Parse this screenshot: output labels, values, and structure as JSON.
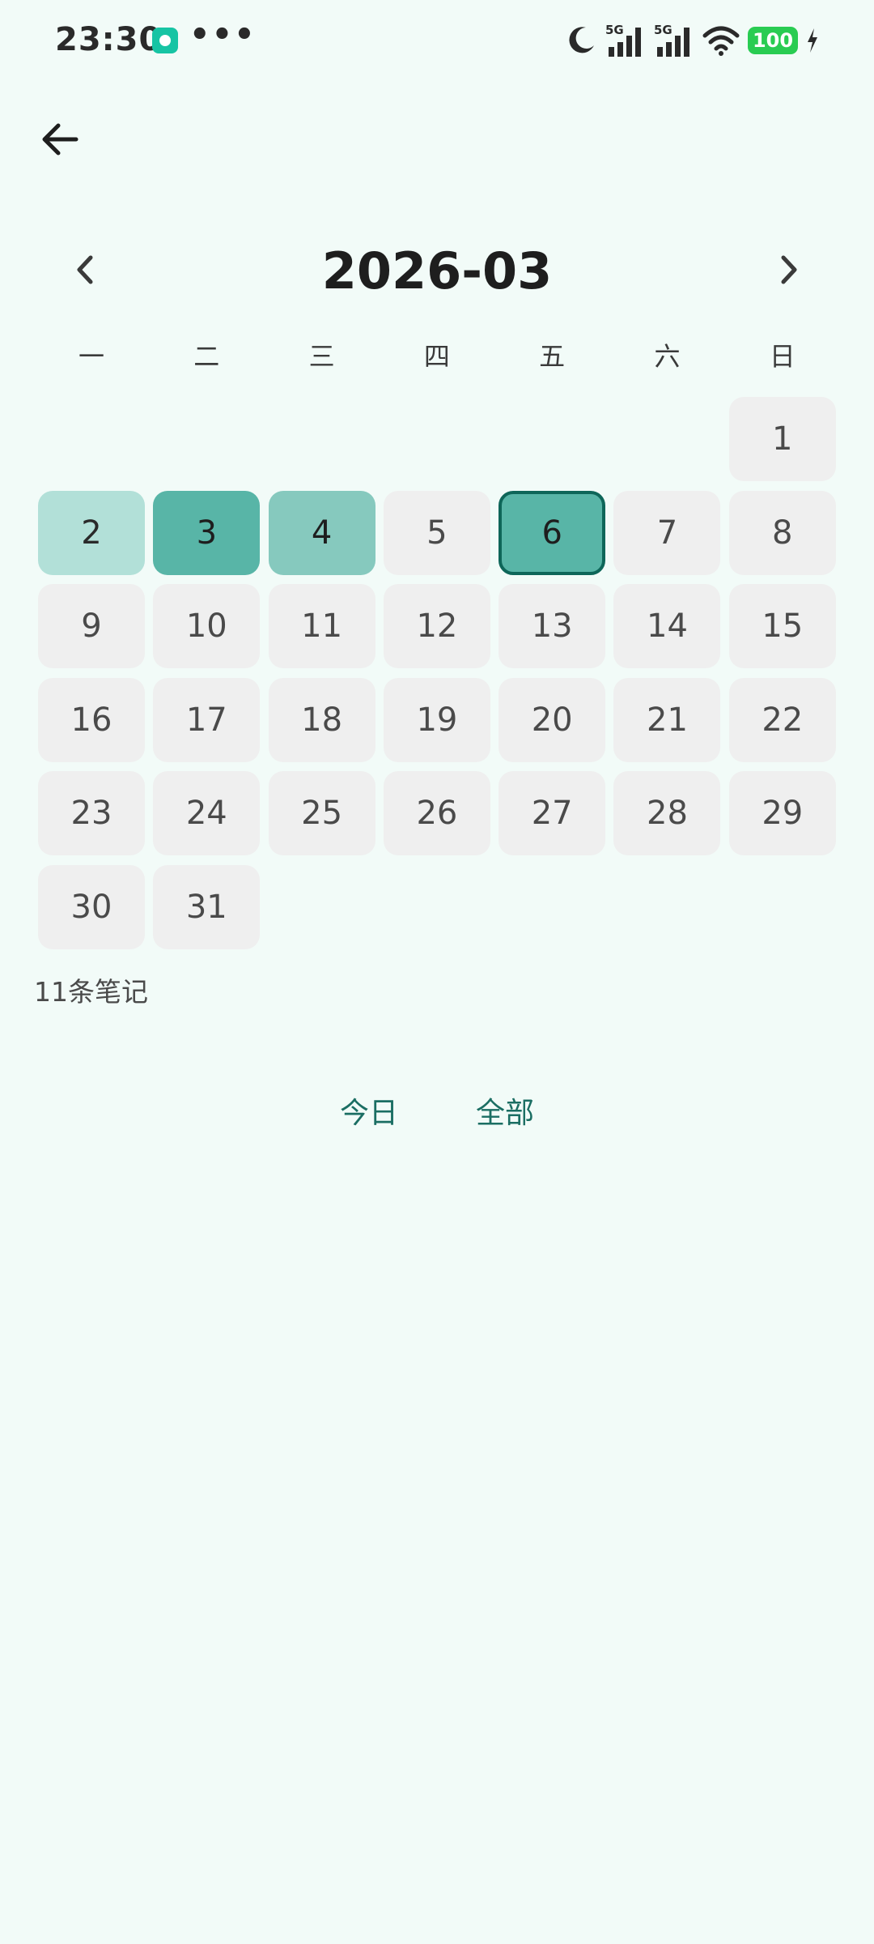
{
  "status_bar": {
    "time": "23:30",
    "more": "•••",
    "battery": "100",
    "signal_1": "5G",
    "signal_2": "5G"
  },
  "header": {
    "month": "2026-03"
  },
  "weekdays": [
    "一",
    "二",
    "三",
    "四",
    "五",
    "六",
    "日"
  ],
  "calendar": {
    "days": [
      {
        "label": "",
        "state": "empty"
      },
      {
        "label": "",
        "state": "empty"
      },
      {
        "label": "",
        "state": "empty"
      },
      {
        "label": "",
        "state": "empty"
      },
      {
        "label": "",
        "state": "empty"
      },
      {
        "label": "",
        "state": "empty"
      },
      {
        "label": "1",
        "state": "normal"
      },
      {
        "label": "2",
        "state": "h1"
      },
      {
        "label": "3",
        "state": "h2"
      },
      {
        "label": "4",
        "state": "h3"
      },
      {
        "label": "5",
        "state": "normal"
      },
      {
        "label": "6",
        "state": "selected"
      },
      {
        "label": "7",
        "state": "normal"
      },
      {
        "label": "8",
        "state": "normal"
      },
      {
        "label": "9",
        "state": "normal"
      },
      {
        "label": "10",
        "state": "normal"
      },
      {
        "label": "11",
        "state": "normal"
      },
      {
        "label": "12",
        "state": "normal"
      },
      {
        "label": "13",
        "state": "normal"
      },
      {
        "label": "14",
        "state": "normal"
      },
      {
        "label": "15",
        "state": "normal"
      },
      {
        "label": "16",
        "state": "normal"
      },
      {
        "label": "17",
        "state": "normal"
      },
      {
        "label": "18",
        "state": "normal"
      },
      {
        "label": "19",
        "state": "normal"
      },
      {
        "label": "20",
        "state": "normal"
      },
      {
        "label": "21",
        "state": "normal"
      },
      {
        "label": "22",
        "state": "normal"
      },
      {
        "label": "23",
        "state": "normal"
      },
      {
        "label": "24",
        "state": "normal"
      },
      {
        "label": "25",
        "state": "normal"
      },
      {
        "label": "26",
        "state": "normal"
      },
      {
        "label": "27",
        "state": "normal"
      },
      {
        "label": "28",
        "state": "normal"
      },
      {
        "label": "29",
        "state": "normal"
      },
      {
        "label": "30",
        "state": "normal"
      },
      {
        "label": "31",
        "state": "normal"
      }
    ]
  },
  "notes": {
    "count_label": "11条笔记"
  },
  "filters": {
    "today": "今日",
    "all": "全部"
  },
  "colors": {
    "background": "#f2fbf8",
    "accent": "#1b6e63",
    "heat_light": "#b2e0d8",
    "heat_mid": "#86c9be",
    "heat_strong": "#58b5a7",
    "selected_border": "#0e6659",
    "cell_default": "#efefef",
    "battery": "#29cc52"
  }
}
